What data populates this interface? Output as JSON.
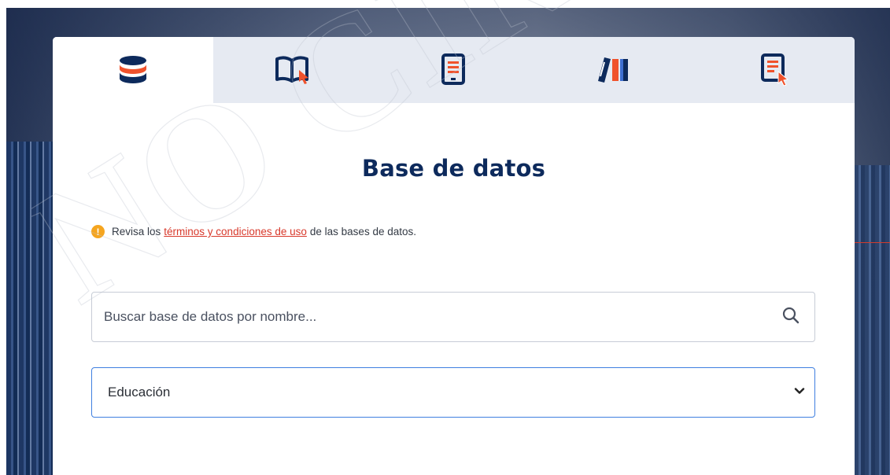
{
  "tabs": [
    {
      "icon": "database-icon",
      "active": true
    },
    {
      "icon": "open-book-icon",
      "active": false
    },
    {
      "icon": "ebook-reader-icon",
      "active": false
    },
    {
      "icon": "books-icon",
      "active": false
    },
    {
      "icon": "document-pointer-icon",
      "active": false
    }
  ],
  "page": {
    "title": "Base de datos"
  },
  "watermark": {
    "text": "NO CIRC"
  },
  "notice": {
    "prefix": "Revisa los",
    "link_text": "términos y condiciones de uso",
    "suffix": "de las bases de datos."
  },
  "search": {
    "placeholder": "Buscar base de datos por nombre...",
    "value": ""
  },
  "filter": {
    "selected": "Educación"
  },
  "colors": {
    "primary_navy": "#0d2a5c",
    "accent_orange": "#f0522c",
    "warning": "#f5a51f",
    "link_red": "#d8392b",
    "focus_blue": "#3f7fe0"
  }
}
